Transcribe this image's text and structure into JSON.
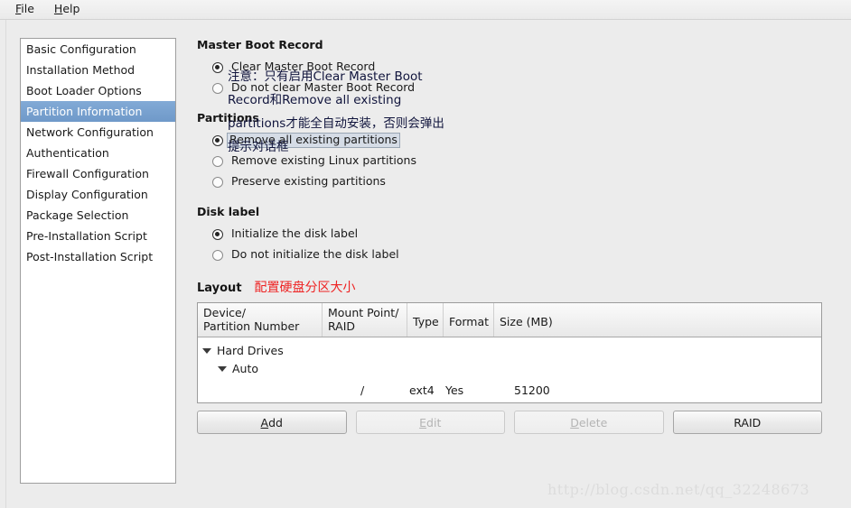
{
  "menubar": {
    "items": [
      {
        "label": "File",
        "mnemonic": "F"
      },
      {
        "label": "Help",
        "mnemonic": "H"
      }
    ]
  },
  "sidebar": {
    "items": [
      {
        "label": "Basic Configuration",
        "selected": false
      },
      {
        "label": "Installation Method",
        "selected": false
      },
      {
        "label": "Boot Loader Options",
        "selected": false
      },
      {
        "label": "Partition Information",
        "selected": true
      },
      {
        "label": "Network Configuration",
        "selected": false
      },
      {
        "label": "Authentication",
        "selected": false
      },
      {
        "label": "Firewall Configuration",
        "selected": false
      },
      {
        "label": "Display Configuration",
        "selected": false
      },
      {
        "label": "Package Selection",
        "selected": false
      },
      {
        "label": "Pre-Installation Script",
        "selected": false
      },
      {
        "label": "Post-Installation Script",
        "selected": false
      }
    ],
    "selection_color": "#7099c9",
    "selection_text_color": "#ffffff"
  },
  "groups": {
    "mbr": {
      "title": "Master Boot Record",
      "options": [
        {
          "label": "Clear Master Boot Record",
          "selected": true,
          "focused": false
        },
        {
          "label": "Do not clear Master Boot Record",
          "selected": false,
          "focused": false
        }
      ]
    },
    "partitions": {
      "title": "Partitions",
      "options": [
        {
          "label": "Remove all existing partitions",
          "selected": true,
          "focused": true
        },
        {
          "label": "Remove existing Linux partitions",
          "selected": false,
          "focused": false
        },
        {
          "label": "Preserve existing partitions",
          "selected": false,
          "focused": false
        }
      ]
    },
    "disk_label": {
      "title": "Disk label",
      "options": [
        {
          "label": "Initialize the disk label",
          "selected": true,
          "focused": false
        },
        {
          "label": "Do not initialize the disk label",
          "selected": false,
          "focused": false
        }
      ]
    }
  },
  "annotations": {
    "note_text": "注意：只有启用Clear Master Boot Record和Remove all existing partitions才能全自动安装，否则会弹出提示对话框",
    "note_color": "#10143c",
    "layout_note": "配置硬盘分区大小",
    "layout_note_color": "#ee2222"
  },
  "layout_section": {
    "title": "Layout",
    "table": {
      "headers": [
        "Device/\nPartition Number",
        "Mount Point/\nRAID",
        "Type",
        "Format",
        "Size (MB)"
      ],
      "headers_split": [
        {
          "line1": "Device/",
          "line2": "Partition Number"
        },
        {
          "line1": "Mount Point/",
          "line2": "RAID"
        },
        {
          "line1": "Type",
          "line2": ""
        },
        {
          "line1": "Format",
          "line2": ""
        },
        {
          "line1": "Size (MB)",
          "line2": ""
        }
      ],
      "rows": [
        {
          "indent": 0,
          "expander": "chevron-down-icon",
          "expanded": true,
          "device": "Hard Drives",
          "mount_point": "",
          "type": "",
          "format": "",
          "size": ""
        },
        {
          "indent": 1,
          "expander": "chevron-down-icon",
          "expanded": true,
          "device": "Auto",
          "mount_point": "",
          "type": "",
          "format": "",
          "size": ""
        },
        {
          "indent": 2,
          "expander": "",
          "expanded": false,
          "device": "",
          "mount_point": "/",
          "type": "ext4",
          "format": "Yes",
          "size": "51200"
        }
      ]
    },
    "buttons": [
      {
        "label": "Add",
        "mnemonic": "A",
        "enabled": true
      },
      {
        "label": "Edit",
        "mnemonic": "E",
        "enabled": false
      },
      {
        "label": "Delete",
        "mnemonic": "D",
        "enabled": false
      },
      {
        "label": "RAID",
        "mnemonic": "",
        "enabled": true
      }
    ]
  },
  "watermark": {
    "text": "http://blog.csdn.net/qq_32248673"
  }
}
